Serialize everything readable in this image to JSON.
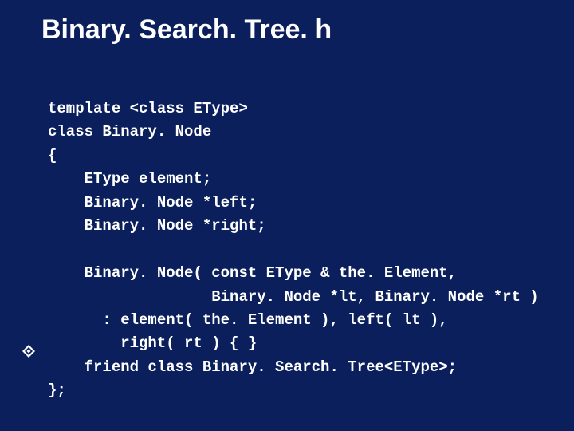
{
  "title": "Binary. Search. Tree. h",
  "code": {
    "l01": "template <class EType>",
    "l02": "class Binary. Node",
    "l03": "{",
    "l04": "    EType element;",
    "l05": "    Binary. Node *left;",
    "l06": "    Binary. Node *right;",
    "l07": "",
    "l08": "    Binary. Node( const EType & the. Element,",
    "l09": "                  Binary. Node *lt, Binary. Node *rt )",
    "l10": "      : element( the. Element ), left( lt ),",
    "l11": "        right( rt ) { }",
    "l12": "    friend class Binary. Search. Tree<EType>;",
    "l13": "};"
  },
  "bullet_icon_name": "diamond-bullet-icon"
}
